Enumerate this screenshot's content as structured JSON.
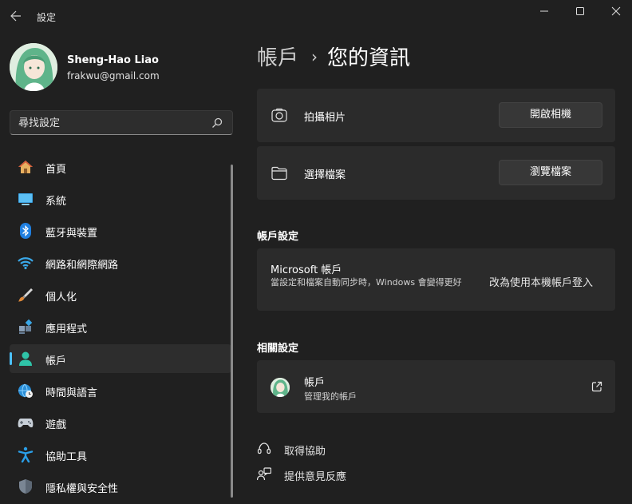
{
  "app": {
    "title": "設定",
    "controls": {
      "minimize": "—",
      "maximize": "☐",
      "close": "✕"
    }
  },
  "profile": {
    "name": "Sheng-Hao Liao",
    "email": "frakwu@gmail.com"
  },
  "search": {
    "placeholder": "尋找設定"
  },
  "sidebar": {
    "items": [
      {
        "label": "首頁",
        "icon": "home-icon"
      },
      {
        "label": "系統",
        "icon": "system-icon"
      },
      {
        "label": "藍牙與裝置",
        "icon": "bluetooth-icon"
      },
      {
        "label": "網路和網際網路",
        "icon": "wifi-icon"
      },
      {
        "label": "個人化",
        "icon": "brush-icon"
      },
      {
        "label": "應用程式",
        "icon": "apps-icon"
      },
      {
        "label": "帳戶",
        "icon": "person-icon",
        "selected": true
      },
      {
        "label": "時間與語言",
        "icon": "globe-clock-icon"
      },
      {
        "label": "遊戲",
        "icon": "gamepad-icon"
      },
      {
        "label": "協助工具",
        "icon": "accessibility-icon"
      },
      {
        "label": "隱私權與安全性",
        "icon": "shield-icon"
      }
    ]
  },
  "breadcrumb": {
    "parent": "帳戶",
    "separator": "›",
    "current": "您的資訊"
  },
  "photo": {
    "take_photo": {
      "label": "拍攝相片",
      "button": "開啟相機",
      "icon": "camera-icon"
    },
    "choose_file": {
      "label": "選擇檔案",
      "button": "瀏覽檔案",
      "icon": "folder-icon"
    }
  },
  "account_settings": {
    "title": "帳戶設定",
    "microsoft": {
      "title": "Microsoft 帳戶",
      "description": "當設定和檔案自動同步時，Windows 會變得更好",
      "link": "改為使用本機帳戶登入"
    }
  },
  "related": {
    "title": "相關設定",
    "accounts": {
      "title": "帳戶",
      "subtitle": "管理我的帳戶",
      "icon": "open-external-icon"
    }
  },
  "footer": {
    "help": "取得協助",
    "feedback": "提供意見反應"
  },
  "colors": {
    "background": "#202020",
    "card": "#2b2b2b",
    "accent": "#4cc2ff"
  }
}
